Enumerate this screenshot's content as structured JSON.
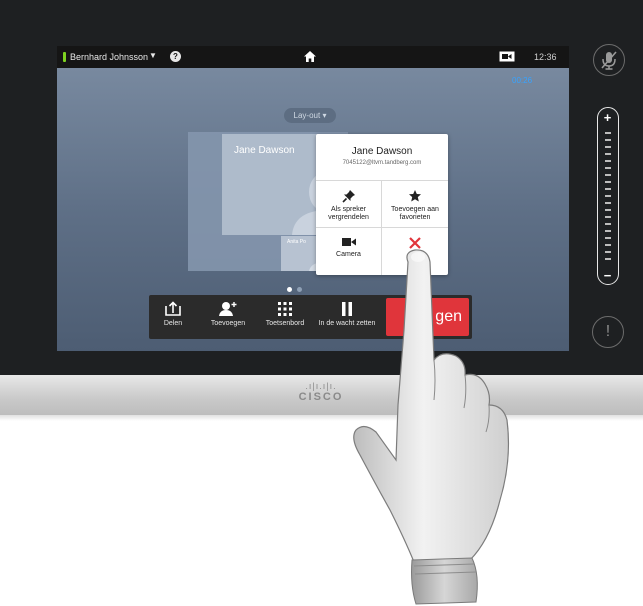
{
  "topbar": {
    "caller_name": "Bernhard Johnsson",
    "clock": "12:36"
  },
  "call": {
    "timer": "00:26"
  },
  "layout": {
    "button_label": "Lay-out"
  },
  "participants": {
    "main_name": "Jane Dawson",
    "small_name": "Anita Po"
  },
  "popup": {
    "name": "Jane Dawson",
    "address": "7045122@ltvm.tandberg.com",
    "actions": [
      {
        "label": "Als spreker vergrendelen",
        "icon": "pin-icon"
      },
      {
        "label": "Toevoegen aan favorieten",
        "icon": "star-icon"
      },
      {
        "label": "Camera",
        "icon": "camera-icon"
      },
      {
        "label": "D",
        "icon": "disconnect-x-icon"
      }
    ]
  },
  "toolbar": {
    "delen": "Delen",
    "toevoegen": "Toevoegen",
    "toetsenbord": "Toetsenbord",
    "wacht": "In de wacht zetten",
    "end": "gen"
  },
  "brand": {
    "logo_text": "CISCO"
  },
  "colors": {
    "end_call": "#e0353b",
    "status_active": "#7ed321",
    "timer": "#37a3ff"
  }
}
